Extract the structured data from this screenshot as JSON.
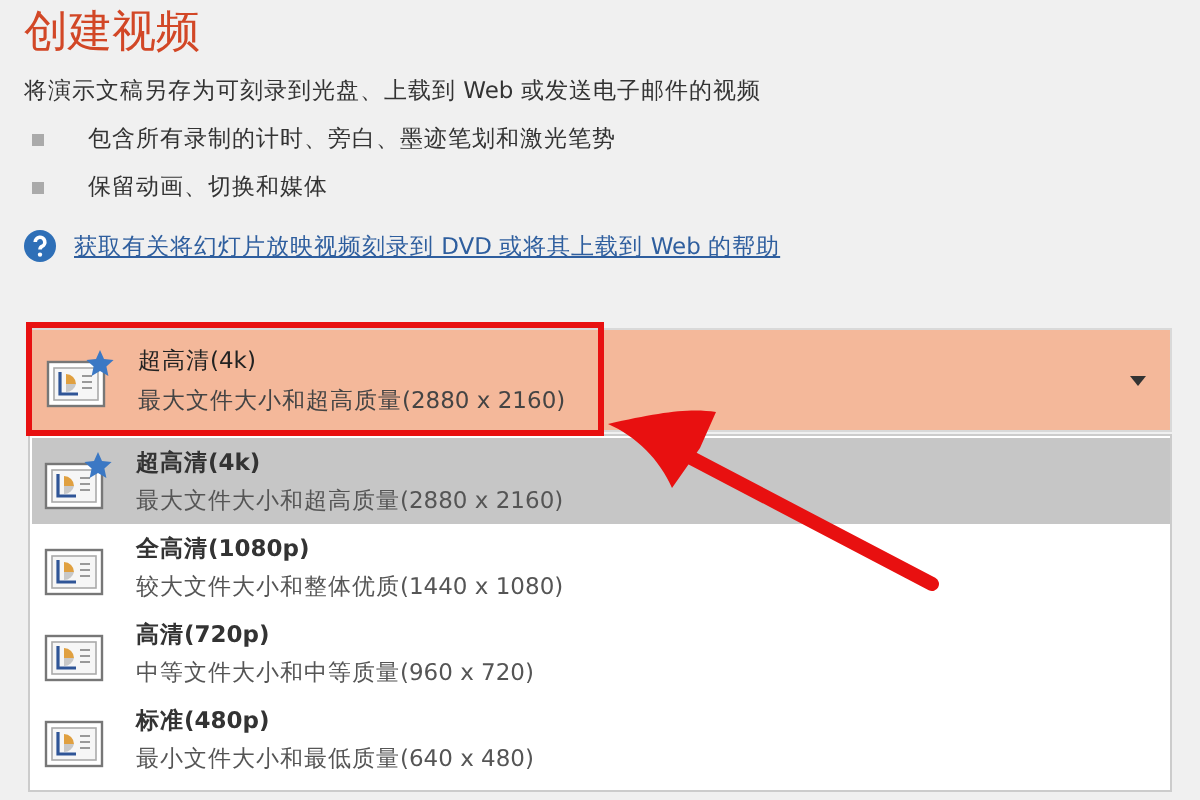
{
  "title": "创建视频",
  "description": "将演示文稿另存为可刻录到光盘、上载到 Web 或发送电子邮件的视频",
  "bullets": [
    "包含所有录制的计时、旁白、墨迹笔划和激光笔势",
    "保留动画、切换和媒体"
  ],
  "help_link": "获取有关将幻灯片放映视频刻录到 DVD 或将其上载到 Web 的帮助",
  "dropdown": {
    "title": "超高清(4k)",
    "subtitle": "最大文件大小和超高质量(2880 x 2160)",
    "starred": true,
    "expanded": true,
    "options": [
      {
        "title": "超高清(4k)",
        "subtitle": "最大文件大小和超高质量(2880 x 2160)",
        "starred": true,
        "selected": true
      },
      {
        "title": "全高清(1080p)",
        "subtitle": "较大文件大小和整体优质(1440 x 1080)",
        "starred": false,
        "selected": false
      },
      {
        "title": "高清(720p)",
        "subtitle": "中等文件大小和中等质量(960 x 720)",
        "starred": false,
        "selected": false
      },
      {
        "title": "标准(480p)",
        "subtitle": "最小文件大小和最低质量(640 x 480)",
        "starred": false,
        "selected": false
      }
    ]
  }
}
